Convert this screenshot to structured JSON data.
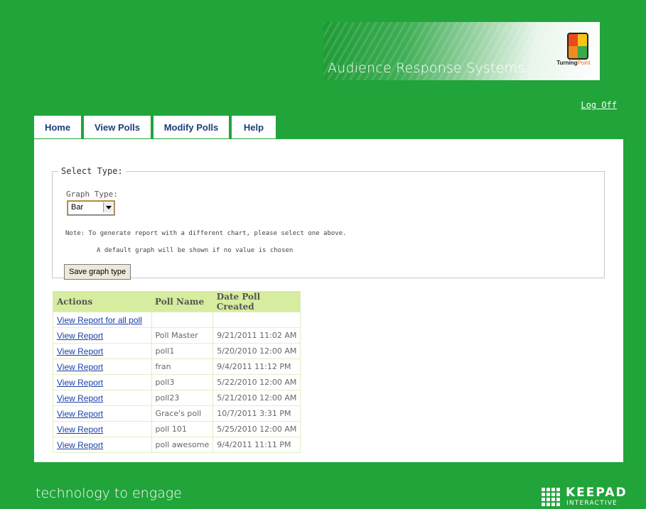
{
  "header": {
    "banner_title": "Audience Response Systems",
    "brand": {
      "name_bold": "Turning",
      "name_light": "Point"
    },
    "logoff_label": "Log Off"
  },
  "nav": {
    "tabs": [
      {
        "label": "Home"
      },
      {
        "label": "View Polls"
      },
      {
        "label": "Modify Polls"
      },
      {
        "label": "Help"
      }
    ]
  },
  "select_type": {
    "legend": "Select Type:",
    "graph_type_label": "Graph Type:",
    "graph_type_value": "Bar",
    "note": "Note: To generate report with a different chart, please select one above.",
    "note2": "A default graph will be shown if no value is chosen",
    "save_button_label": "Save graph type"
  },
  "polls_table": {
    "headers": [
      "Actions",
      "Poll Name",
      "Date Poll Created"
    ],
    "rows": [
      {
        "action": "View Report for all poll",
        "name": "",
        "date": ""
      },
      {
        "action": "View Report",
        "name": "Poll Master",
        "date": "9/21/2011 11:02 AM"
      },
      {
        "action": "View Report",
        "name": "poll1",
        "date": "5/20/2010 12:00 AM"
      },
      {
        "action": "View Report",
        "name": "fran",
        "date": "9/4/2011 11:12 PM"
      },
      {
        "action": "View Report",
        "name": "poll3",
        "date": "5/22/2010 12:00 AM"
      },
      {
        "action": "View Report",
        "name": "poll23",
        "date": "5/21/2010 12:00 AM"
      },
      {
        "action": "View Report",
        "name": "Grace's poll",
        "date": "10/7/2011 3:31 PM"
      },
      {
        "action": "View Report",
        "name": "poll 101",
        "date": "5/25/2010 12:00 AM"
      },
      {
        "action": "View Report",
        "name": "poll awesome",
        "date": "9/4/2011 11:11 PM"
      }
    ]
  },
  "footer": {
    "tagline": "technology to engage",
    "logo_word": "KEEPAD",
    "logo_sub": "INTERACTIVE"
  },
  "colors": {
    "page_background": "#21a43a",
    "tab_text": "#1a3f7a",
    "table_header": "#d6ec9e",
    "link": "#1a3fa8"
  }
}
